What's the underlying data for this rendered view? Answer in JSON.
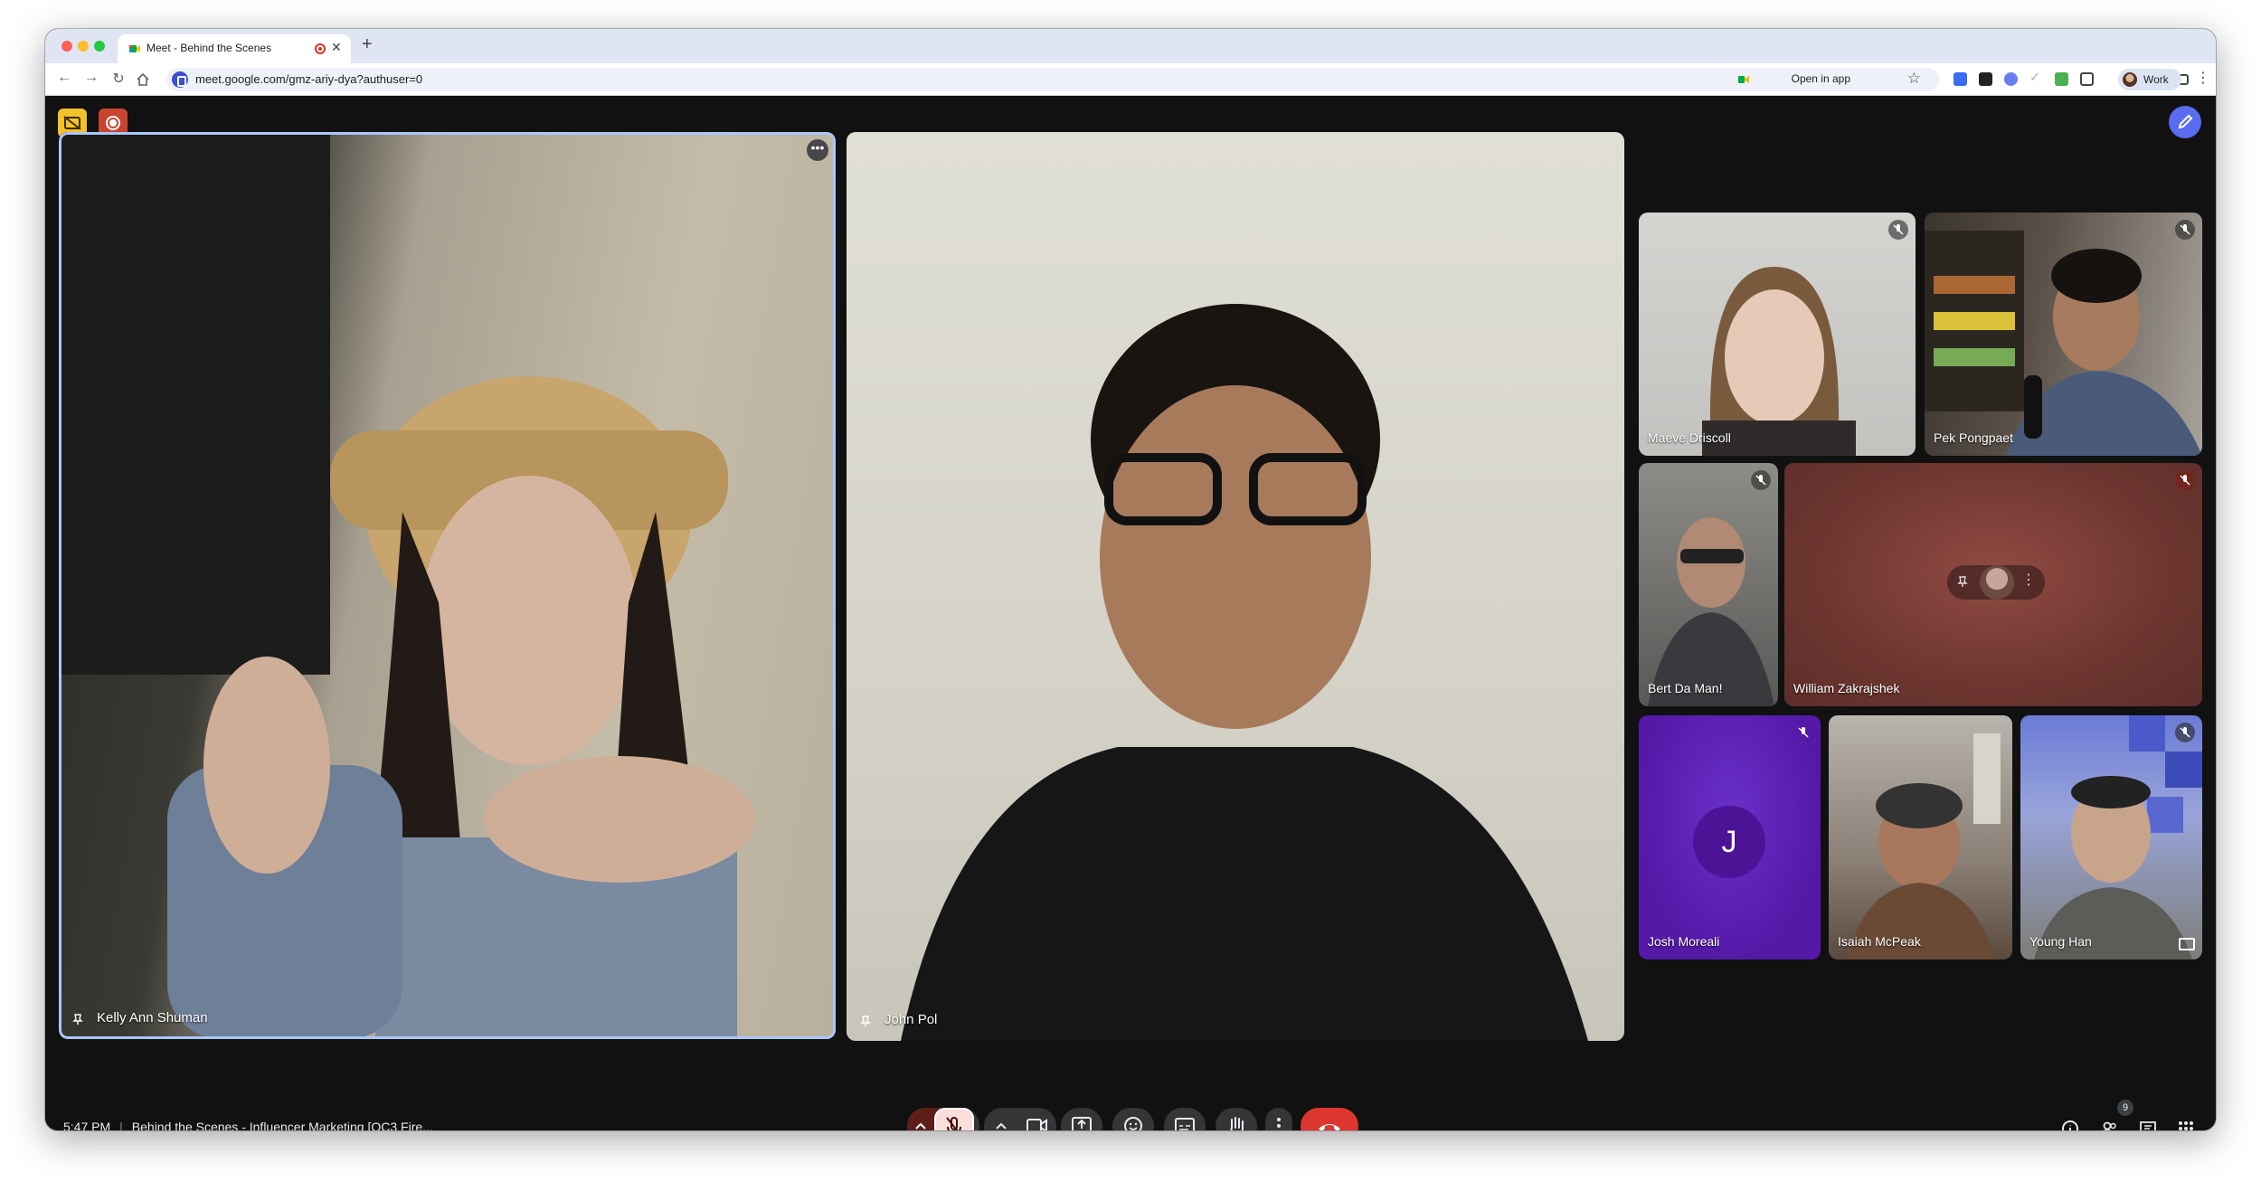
{
  "browser": {
    "tab_title": "Meet - Behind the Scenes",
    "url": "meet.google.com/gmz-ariy-dya?authuser=0",
    "open_in_app": "Open in app",
    "profile": "Work"
  },
  "meet": {
    "time": "5:47 PM",
    "separator": "|",
    "meeting_title": "Behind the Scenes - Influencer Marketing [OC3 Fire...",
    "people_count": "9",
    "josh_initial": "J",
    "participants": {
      "kelly": "Kelly Ann Shuman",
      "john": "John Pol",
      "maeve": "Maeve Driscoll",
      "pek": "Pek Pongpaet",
      "bert": "Bert Da Man!",
      "william": "William Zakrajshek",
      "josh": "Josh Moreali",
      "isaiah": "Isaiah McPeak",
      "young": "Young Han"
    }
  },
  "colors": {
    "end_call": "#dc362e",
    "mic_muted_bg": "#f9dedc",
    "active_speaker_ring": "#a8c7fa",
    "pen_button": "#5a6cf0"
  },
  "icons": [
    "close-icon",
    "plus-icon",
    "back-arrow-icon",
    "forward-arrow-icon",
    "reload-icon",
    "home-icon",
    "star-icon",
    "mic-off-icon",
    "camera-icon",
    "present-icon",
    "emoji-icon",
    "captions-icon",
    "raise-hand-icon",
    "more-vert-icon",
    "end-call-icon",
    "info-icon",
    "people-icon",
    "chat-icon",
    "apps-grid-icon",
    "pin-icon",
    "pen-icon",
    "record-icon"
  ]
}
